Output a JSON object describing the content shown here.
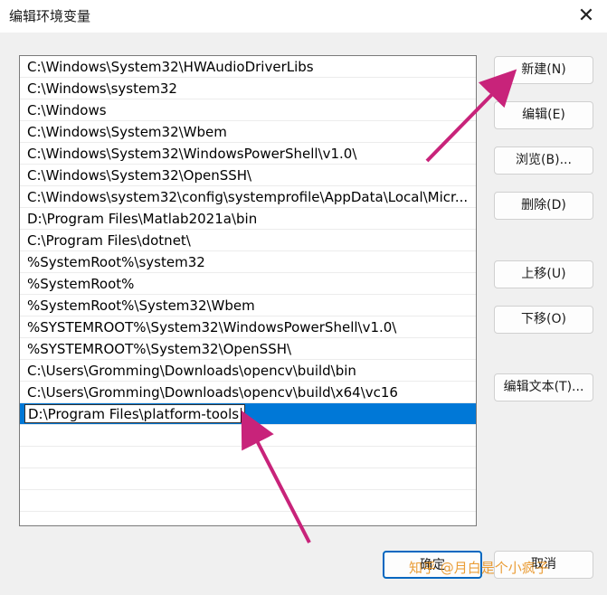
{
  "window": {
    "title": "编辑环境变量",
    "close_glyph": "✕"
  },
  "paths": [
    "C:\\Windows\\System32\\HWAudioDriverLibs",
    "C:\\Windows\\system32",
    "C:\\Windows",
    "C:\\Windows\\System32\\Wbem",
    "C:\\Windows\\System32\\WindowsPowerShell\\v1.0\\",
    "C:\\Windows\\System32\\OpenSSH\\",
    "C:\\Windows\\system32\\config\\systemprofile\\AppData\\Local\\Micr...",
    "D:\\Program Files\\Matlab2021a\\bin",
    "C:\\Program Files\\dotnet\\",
    "%SystemRoot%\\system32",
    "%SystemRoot%",
    "%SystemRoot%\\System32\\Wbem",
    "%SYSTEMROOT%\\System32\\WindowsPowerShell\\v1.0\\",
    "%SYSTEMROOT%\\System32\\OpenSSH\\",
    "C:\\Users\\Gromming\\Downloads\\opencv\\build\\bin",
    "C:\\Users\\Gromming\\Downloads\\opencv\\build\\x64\\vc16"
  ],
  "editing_value": "D:\\Program Files\\platform-tools",
  "buttons": {
    "new": "新建(N)",
    "edit": "编辑(E)",
    "browse": "浏览(B)...",
    "delete": "删除(D)",
    "move_up": "上移(U)",
    "move_down": "下移(O)",
    "edit_text": "编辑文本(T)...",
    "ok": "确定",
    "cancel": "取消"
  },
  "watermark": "知乎 @月白是个小疯子",
  "colors": {
    "selection": "#0078d7",
    "annotation_arrow": "#c8237a",
    "watermark": "#e68c14"
  }
}
